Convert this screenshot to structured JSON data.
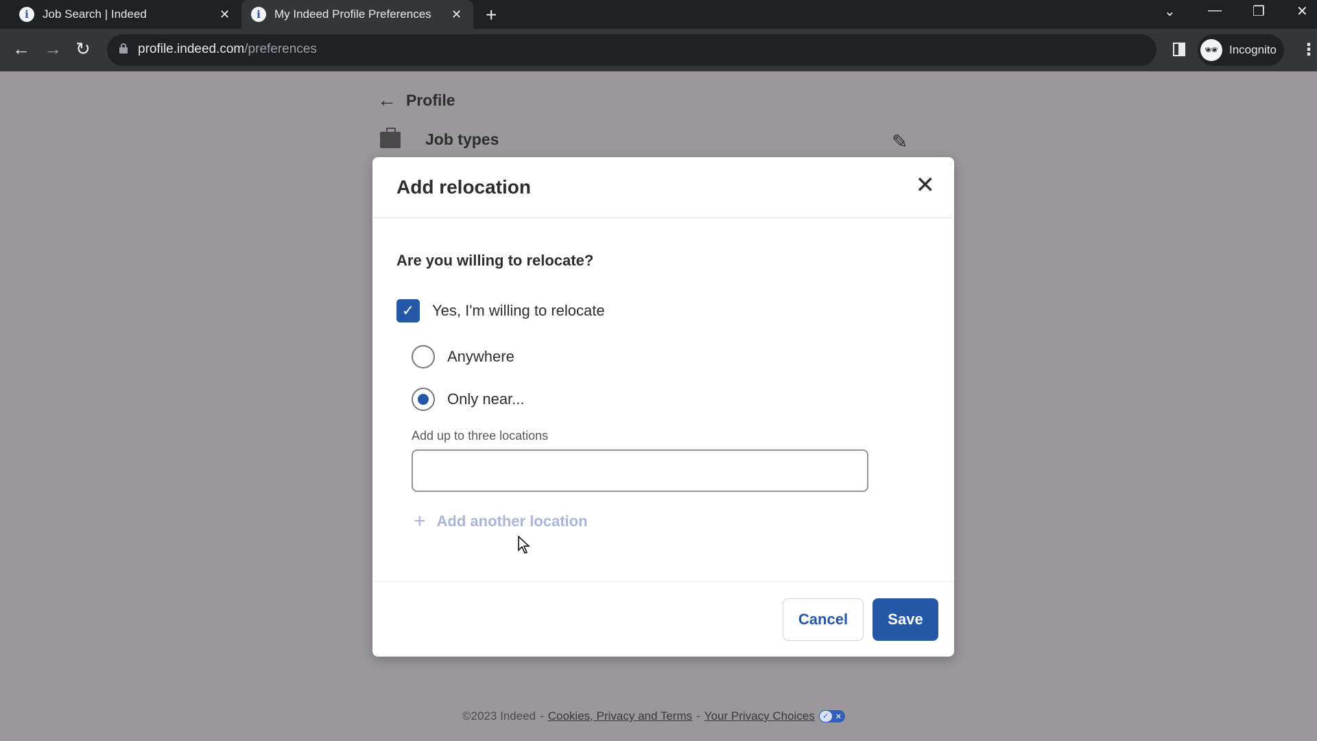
{
  "browser": {
    "tabs": [
      {
        "title": "Job Search | Indeed",
        "favicon": "i",
        "active": false
      },
      {
        "title": "My Indeed Profile Preferences",
        "favicon": "i",
        "active": true
      }
    ],
    "new_tab": "+",
    "url_host": "profile.indeed.com",
    "url_path": "/preferences",
    "profile_label": "Incognito",
    "window_controls": {
      "tab_search": "⌄",
      "minimize": "—",
      "restore": "❐",
      "close": "✕"
    },
    "nav": {
      "back": "←",
      "forward": "→",
      "reload": "↻"
    },
    "bookmark_star": "☆",
    "menu": "⋮"
  },
  "page": {
    "back_label": "Profile",
    "back_arrow": "←",
    "section_label": "Job types",
    "edit_icon": "✎"
  },
  "modal": {
    "title": "Add relocation",
    "close_glyph": "✕",
    "question": "Are you willing to relocate?",
    "willing_checkbox": {
      "label": "Yes, I'm willing to relocate",
      "checked": true,
      "glyph": "✓"
    },
    "options": [
      {
        "label": "Anywhere",
        "selected": false
      },
      {
        "label": "Only near...",
        "selected": true
      }
    ],
    "locations_label": "Add up to three locations",
    "location_value": "",
    "add_another_label": "Add another location",
    "add_another_glyph": "+",
    "cancel_label": "Cancel",
    "save_label": "Save"
  },
  "footer": {
    "copyright": "©2023 Indeed",
    "separator": "-",
    "cookies_link": "Cookies, Privacy and Terms",
    "privacy_link": "Your Privacy Choices",
    "toggle_on": "✓",
    "toggle_off": "✕"
  },
  "colors": {
    "brand_blue": "#2557a7",
    "overlay": "#9a989b",
    "chrome_dark": "#202124"
  }
}
